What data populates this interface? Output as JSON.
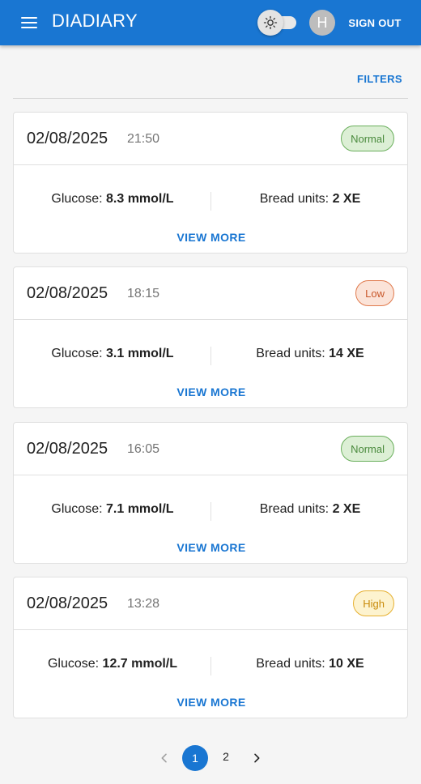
{
  "app": {
    "title": "DIADIARY",
    "menu_icon": "hamburger-menu-icon",
    "theme_icon": "sun-icon",
    "avatar_letter": "H",
    "sign_out_label": "SIGN OUT",
    "primary_color": "#1976d2"
  },
  "toolbar": {
    "filters_label": "FILTERS"
  },
  "entries": [
    {
      "date": "02/08/2025",
      "time": "21:50",
      "status": "Normal",
      "glucose_label": "Glucose:",
      "glucose_value": "8.3 mmol/L",
      "bread_label": "Bread units:",
      "bread_value": "2 XE",
      "view_more_label": "VIEW MORE"
    },
    {
      "date": "02/08/2025",
      "time": "18:15",
      "status": "Low",
      "glucose_label": "Glucose:",
      "glucose_value": "3.1 mmol/L",
      "bread_label": "Bread units:",
      "bread_value": "14 XE",
      "view_more_label": "VIEW MORE"
    },
    {
      "date": "02/08/2025",
      "time": "16:05",
      "status": "Normal",
      "glucose_label": "Glucose:",
      "glucose_value": "7.1 mmol/L",
      "bread_label": "Bread units:",
      "bread_value": "2 XE",
      "view_more_label": "VIEW MORE"
    },
    {
      "date": "02/08/2025",
      "time": "13:28",
      "status": "High",
      "glucose_label": "Glucose:",
      "glucose_value": "12.7 mmol/L",
      "bread_label": "Bread units:",
      "bread_value": "10 XE",
      "view_more_label": "VIEW MORE"
    }
  ],
  "pagination": {
    "prev_icon": "chevron-left-icon",
    "next_icon": "chevron-right-icon",
    "pages": [
      "1",
      "2"
    ],
    "current": "1"
  }
}
